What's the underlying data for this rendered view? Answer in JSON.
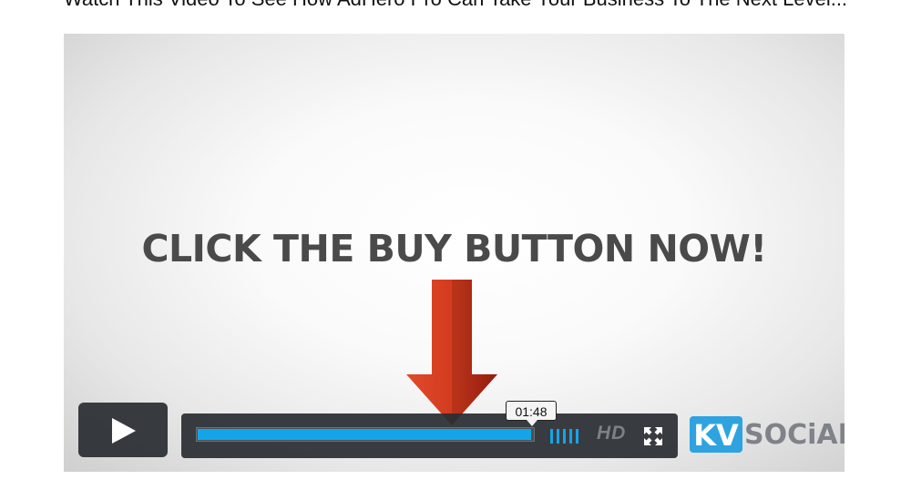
{
  "page": {
    "heading": "Watch This Video To See How AdHero Pro Can Take Your Business To The Next Level..."
  },
  "video": {
    "headline": "CLICK THE BUY BUTTON NOW!",
    "arrow_color": "#d23a1e",
    "controls": {
      "play_icon": "play-icon",
      "progress_fraction": 0.995,
      "time_tooltip": "01:48",
      "volume_bars": 5,
      "hd_label": "HD",
      "fullscreen_icon": "fullscreen-icon",
      "accent_color": "#13a5e8"
    },
    "logo": {
      "box_text": "KV",
      "text": "SOCiAL"
    }
  }
}
